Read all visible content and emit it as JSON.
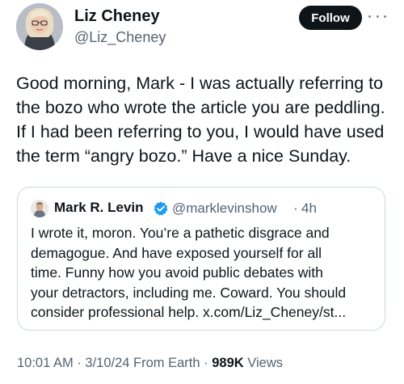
{
  "author": {
    "name": "Liz Cheney",
    "handle": "@Liz_Cheney",
    "follow_label": "Follow",
    "more_icon": "more-horizontal-icon"
  },
  "tweet": {
    "lines": [
      "Good morning, Mark - I was actually referring to",
      "the bozo who wrote the article you are peddling.",
      "If I had been referring to you, I would have used",
      "the term “angry bozo.” Have a nice Sunday."
    ]
  },
  "quote": {
    "name": "Mark R. Levin",
    "verified_icon": "verified-badge-icon",
    "handle": "@marklevinshow",
    "separator": "·",
    "time": "4h",
    "lines": [
      "I wrote it, moron. You’re a pathetic disgrace and",
      "demagogue. And have exposed yourself for all",
      "time. Funny how you avoid public debates with",
      "your detractors, including me. Coward. You should",
      "consider professional help. x.com/Liz_Cheney/st..."
    ]
  },
  "meta": {
    "time": "10:01 AM",
    "separator1": " · ",
    "date": "3/10/24",
    "source": " From Earth",
    "separator2": " · ",
    "views_count": "989K",
    "views_label": " Views"
  },
  "colors": {
    "text": "#0f1419",
    "secondary": "#536471",
    "verified": "#1d9bf0",
    "border": "#cfd9de"
  }
}
